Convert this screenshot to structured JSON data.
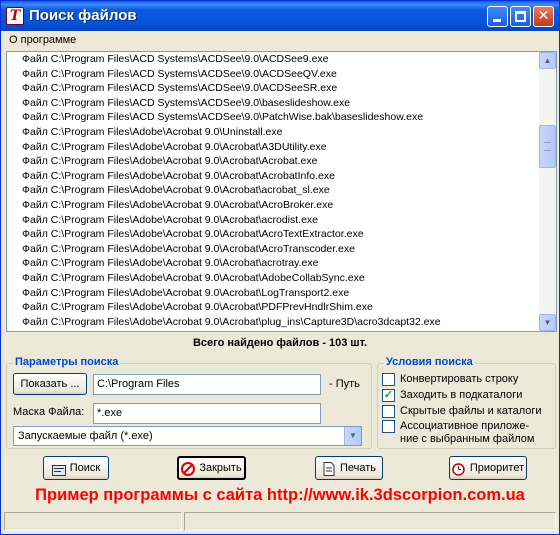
{
  "window": {
    "title": "Поиск файлов",
    "app_icon_glyph": "T",
    "controls": {
      "minimize": "minimize-icon",
      "maximize": "maximize-icon",
      "close": "✕"
    }
  },
  "menu": {
    "items": [
      "О программе"
    ]
  },
  "file_list": {
    "rows": [
      "Файл C:\\Program Files\\ACD Systems\\ACDSee\\9.0\\ACDSee9.exe",
      "Файл C:\\Program Files\\ACD Systems\\ACDSee\\9.0\\ACDSeeQV.exe",
      "Файл C:\\Program Files\\ACD Systems\\ACDSee\\9.0\\ACDSeeSR.exe",
      "Файл C:\\Program Files\\ACD Systems\\ACDSee\\9.0\\baseslideshow.exe",
      "Файл C:\\Program Files\\ACD Systems\\ACDSee\\9.0\\PatchWise.bak\\baseslideshow.exe",
      "Файл C:\\Program Files\\Adobe\\Acrobat 9.0\\Uninstall.exe",
      "Файл C:\\Program Files\\Adobe\\Acrobat 9.0\\Acrobat\\A3DUtility.exe",
      "Файл C:\\Program Files\\Adobe\\Acrobat 9.0\\Acrobat\\Acrobat.exe",
      "Файл C:\\Program Files\\Adobe\\Acrobat 9.0\\Acrobat\\AcrobatInfo.exe",
      "Файл C:\\Program Files\\Adobe\\Acrobat 9.0\\Acrobat\\acrobat_sl.exe",
      "Файл C:\\Program Files\\Adobe\\Acrobat 9.0\\Acrobat\\AcroBroker.exe",
      "Файл C:\\Program Files\\Adobe\\Acrobat 9.0\\Acrobat\\acrodist.exe",
      "Файл C:\\Program Files\\Adobe\\Acrobat 9.0\\Acrobat\\AcroTextExtractor.exe",
      "Файл C:\\Program Files\\Adobe\\Acrobat 9.0\\Acrobat\\AcroTranscoder.exe",
      "Файл C:\\Program Files\\Adobe\\Acrobat 9.0\\Acrobat\\acrotray.exe",
      "Файл C:\\Program Files\\Adobe\\Acrobat 9.0\\Acrobat\\AdobeCollabSync.exe",
      "Файл C:\\Program Files\\Adobe\\Acrobat 9.0\\Acrobat\\LogTransport2.exe",
      "Файл C:\\Program Files\\Adobe\\Acrobat 9.0\\Acrobat\\PDFPrevHndlrShim.exe",
      "Файл C:\\Program Files\\Adobe\\Acrobat 9.0\\Acrobat\\plug_ins\\Capture3D\\acro3dcapt32.exe"
    ]
  },
  "total": {
    "text": "Всего найдено файлов -    103   шт."
  },
  "search_params": {
    "title": "Параметры поиска",
    "browse_label": "Показать ...",
    "path_value": "C:\\Program Files",
    "path_label": "- Путь",
    "mask_label": "Маска Файла:",
    "mask_value": "*.exe",
    "type_select_value": "Запускаемые файл (*.exe)"
  },
  "conditions": {
    "title": "Условия поиска",
    "options": [
      {
        "label": "Конвертировать строку",
        "checked": false
      },
      {
        "label": "Заходить в подкаталоги",
        "checked": true
      },
      {
        "label": "Скрытые файлы и каталоги",
        "checked": false
      },
      {
        "label": "Ассоциативное приложе-",
        "label_line2": "ние с выбранным файлом",
        "checked": false
      }
    ]
  },
  "buttons": {
    "search": "Поиск",
    "close": "Закрыть",
    "print": "Печать",
    "priority": "Приоритет"
  },
  "promo": "Пример программы с сайта http://www.ik.3dscorpion.com.ua",
  "colors": {
    "titlebar": "#0a5ae0",
    "group_title": "#0046d5",
    "promo": "#ff0000"
  }
}
